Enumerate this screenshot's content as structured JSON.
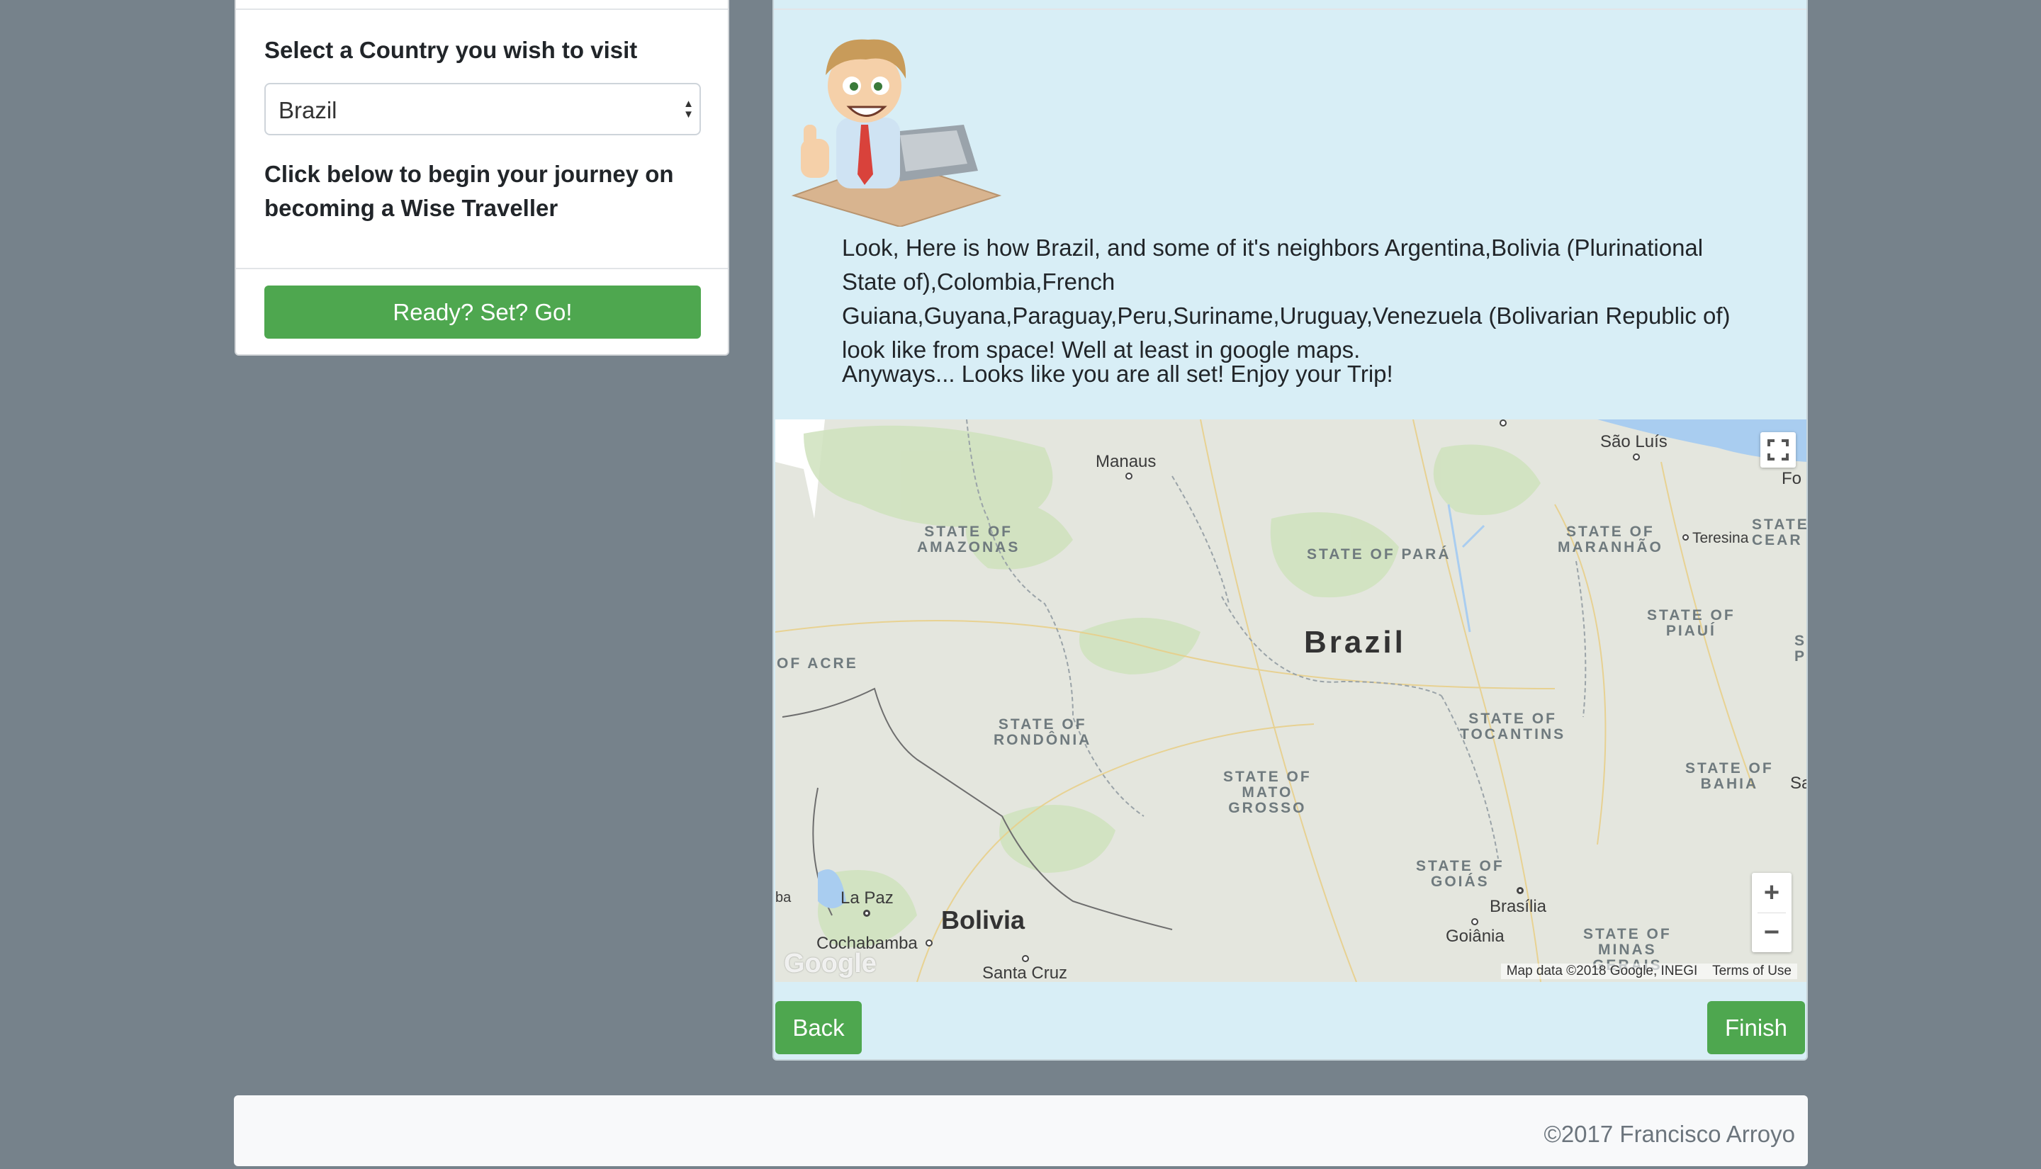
{
  "left_card": {
    "select_label": "Select a Country you wish to visit",
    "select_value": "Brazil",
    "begin_text": "Click below to begin your journey on becoming a Wise Traveller",
    "go_button": "Ready? Set? Go!"
  },
  "right_card": {
    "message_1": "Look, Here is how Brazil, and some of it's neighbors Argentina,Bolivia (Plurinational State of),Colombia,French Guiana,Guyana,Paraguay,Peru,Suriname,Uruguay,Venezuela (Bolivarian Republic of) look like from space! Well at least in google maps.",
    "message_2": "Anyways... Looks like you are all set! Enjoy your Trip!",
    "back_button": "Back",
    "finish_button": "Finish"
  },
  "map": {
    "country_main": "Brazil",
    "country_secondary": "Bolivia",
    "states": {
      "amazonas": "STATE OF\nAMAZONAS",
      "para": "STATE OF PARÁ",
      "maranhao": "STATE OF\nMARANHÃO",
      "ceara": "STATE\nCEAR",
      "piaui": "STATE OF\nPIAUÍ",
      "acre": "OF ACRE",
      "rondonia": "STATE OF\nRONDÔNIA",
      "tocantins": "STATE OF\nTOCANTINS",
      "mato_grosso": "STATE OF\nMATO\nGROSSO",
      "bahia": "STATE OF\nBAHIA",
      "goias": "STATE OF\nGOIÁS",
      "minas": "STATE OF\nMINAS\nGERAIS",
      "pern": "S\nPER"
    },
    "cities": {
      "manaus": "Manaus",
      "sao_luis": "São Luís",
      "teresina": "Teresina",
      "fortaleza": "Fo",
      "brasilia": "Brasília",
      "goiania": "Goiânia",
      "la_paz": "La Paz",
      "cochabamba": "Cochabamba",
      "santa_cruz": "Santa Cruz",
      "salvador": "Sa",
      "west": "ba"
    },
    "zoom_in": "+",
    "zoom_out": "−",
    "attribution": "Map data ©2018 Google, INEGI",
    "terms": "Terms of Use",
    "logo": "Google"
  },
  "footer": {
    "text": "©2017 Francisco Arroyo"
  },
  "colors": {
    "background": "#76828b",
    "button_green": "#4ea74f",
    "panel_blue": "#d8eef6"
  }
}
